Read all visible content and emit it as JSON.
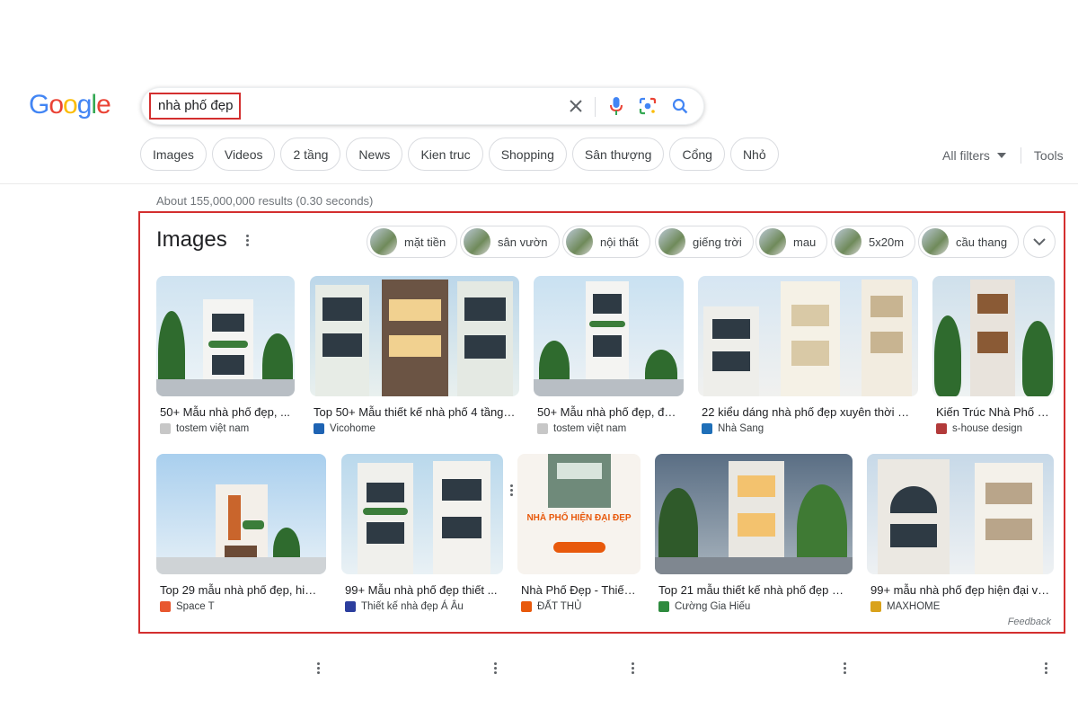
{
  "logo": {
    "text": "Google"
  },
  "search": {
    "query": "nhà phố đẹp",
    "clear_icon": "close-icon",
    "voice_icon": "microphone-icon",
    "lens_icon": "lens-icon",
    "search_icon": "search-icon"
  },
  "chips": [
    "Images",
    "Videos",
    "2 tầng",
    "News",
    "Kien truc",
    "Shopping",
    "Sân thượng",
    "Cổng",
    "Nhỏ"
  ],
  "filters": {
    "all_filters": "All filters",
    "tools": "Tools"
  },
  "stats": "About 155,000,000 results (0.30 seconds)",
  "images": {
    "title": "Images",
    "refinements": [
      "mặt tiền",
      "sân vườn",
      "nội thất",
      "giếng trời",
      "mau",
      "5x20m",
      "cầu thang"
    ],
    "results": [
      {
        "caption": "50+ Mẫu nhà phố đẹp, ...",
        "source": "tostem việt nam"
      },
      {
        "caption": "Top 50+ Mẫu thiết kế nhà phố 4 tầng ...",
        "source": "Vicohome"
      },
      {
        "caption": "50+ Mẫu nhà phố đẹp, đơ...",
        "source": "tostem việt nam"
      },
      {
        "caption": "22 kiểu dáng nhà phố đẹp xuyên thời gi...",
        "source": "Nhà Sang"
      },
      {
        "caption": "Kiến Trúc Nhà Phố Đ...",
        "source": "s-house design"
      },
      {
        "caption": "Top 29 mẫu nhà phố đẹp, hiện...",
        "source": "Space T"
      },
      {
        "caption": "99+ Mẫu nhà phố đẹp thiết ...",
        "source": "Thiết kế nhà đẹp Á Âu"
      },
      {
        "caption": "Nhà Phố Đẹp - Thiết ...",
        "source": "ĐẤT THỦ",
        "overlay": "NHÀ PHỐ HIỆN ĐẠI ĐẸP"
      },
      {
        "caption": "Top 21 mẫu thiết kế nhà phố đẹp hi...",
        "source": "Cường Gia Hiếu"
      },
      {
        "caption": "99+ mẫu nhà phố đẹp hiện đại và ...",
        "source": "MAXHOME"
      }
    ],
    "feedback": "Feedback"
  },
  "colors": {
    "highlight_border": "#d32f2f",
    "google_blue": "#4285f4",
    "google_red": "#ea4335",
    "google_yellow": "#fbbc05",
    "google_green": "#34a853"
  }
}
